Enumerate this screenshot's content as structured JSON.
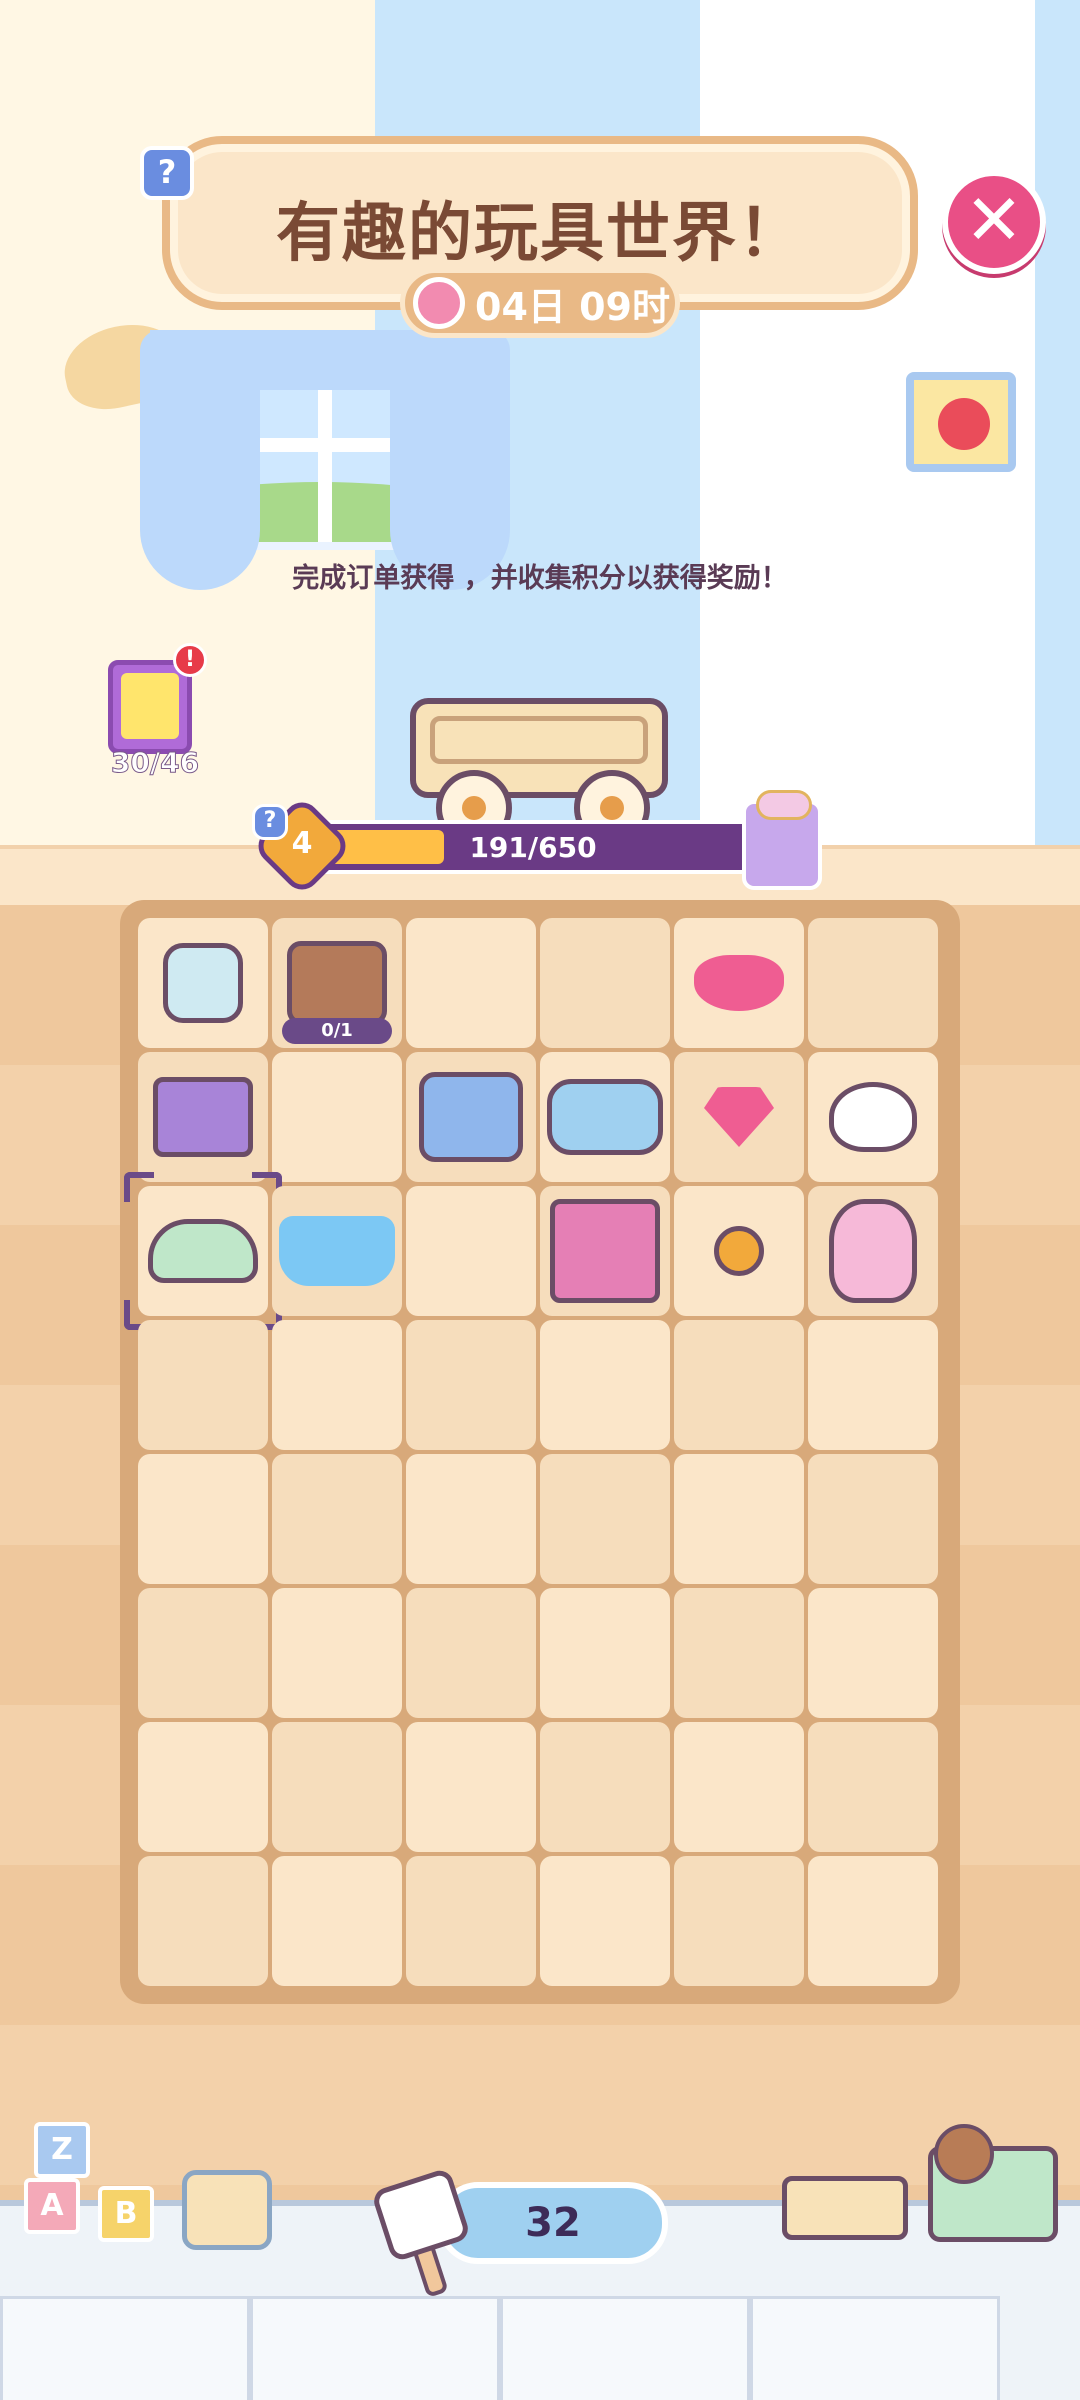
{
  "header": {
    "title": "有趣的玩具世界！",
    "timer": "04日 09时",
    "close_label": "✕",
    "help_label": "?"
  },
  "instruction": "完成订单获得 ，并收集积分以获得奖励！",
  "collection_book": {
    "count": "30/46",
    "alert": "!"
  },
  "level": {
    "number": "4",
    "progress_text": "191/650",
    "progress_fraction": 0.294,
    "help_label": "?"
  },
  "board": {
    "rows": 8,
    "cols": 6,
    "cells": [
      {
        "item": "robot-toy",
        "cls": "robot"
      },
      {
        "item": "toy-chest-producer",
        "cls": "chest",
        "tag": "0/1"
      },
      {
        "item": ""
      },
      {
        "item": ""
      },
      {
        "item": "pink-gems",
        "cls": "gems2"
      },
      {
        "item": ""
      },
      {
        "item": "building-blocks",
        "cls": "blocks"
      },
      {
        "item": ""
      },
      {
        "item": "toy-train",
        "cls": "train"
      },
      {
        "item": "toy-bus",
        "cls": "bus"
      },
      {
        "item": "pink-gem",
        "cls": "gem"
      },
      {
        "item": "rubber-duck",
        "cls": "duck"
      },
      {
        "item": "toy-car",
        "cls": "car",
        "selected": true
      },
      {
        "item": "bath-toy",
        "cls": "bath"
      },
      {
        "item": ""
      },
      {
        "item": "lego-bricks",
        "cls": "lego"
      },
      {
        "item": "energy-coin",
        "cls": "coin"
      },
      {
        "item": "teddy-bear",
        "cls": "bear"
      }
    ]
  },
  "footer": {
    "hammer_count": "32",
    "blocks": [
      "Z",
      "A",
      "B"
    ]
  },
  "colors": {
    "accent_pink": "#e94f86",
    "level_purple": "#6a3a85",
    "progress_yellow": "#ffbf47"
  }
}
